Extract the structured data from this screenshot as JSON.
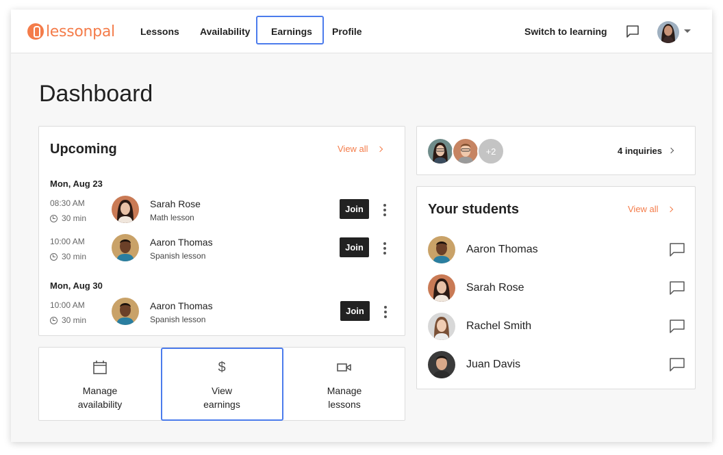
{
  "brand": {
    "name": "lessonpal",
    "accent": "#f47c4a"
  },
  "nav": {
    "items": [
      {
        "label": "Lessons"
      },
      {
        "label": "Availability"
      },
      {
        "label": "Earnings"
      },
      {
        "label": "Profile"
      }
    ],
    "switch_label": "Switch to learning",
    "message_icon": "chat-bubble-icon",
    "user_menu_icon": "chevron-down-icon"
  },
  "page": {
    "title": "Dashboard"
  },
  "upcoming": {
    "title": "Upcoming",
    "view_all": "View all",
    "groups": [
      {
        "date": "Mon, Aug 23",
        "lessons": [
          {
            "time": "08:30 AM",
            "duration": "30 min",
            "name": "Sarah Rose",
            "subject": "Math lesson",
            "join": "Join"
          },
          {
            "time": "10:00 AM",
            "duration": "30 min",
            "name": "Aaron Thomas",
            "subject": "Spanish lesson",
            "join": "Join"
          }
        ]
      },
      {
        "date": "Mon, Aug 30",
        "lessons": [
          {
            "time": "10:00 AM",
            "duration": "30 min",
            "name": "Aaron Thomas",
            "subject": "Spanish lesson",
            "join": "Join"
          }
        ]
      }
    ]
  },
  "actions": [
    {
      "label": "Manage\navailability",
      "icon": "calendar-icon"
    },
    {
      "label": "View\nearnings",
      "icon": "dollar-icon"
    },
    {
      "label": "Manage\nlessons",
      "icon": "video-camera-icon"
    }
  ],
  "inquiries": {
    "extra": "+2",
    "label": "4 inquiries"
  },
  "students": {
    "title": "Your students",
    "view_all": "View all",
    "list": [
      {
        "name": "Aaron Thomas"
      },
      {
        "name": "Sarah Rose"
      },
      {
        "name": "Rachel Smith"
      },
      {
        "name": "Juan Davis"
      }
    ]
  },
  "colors": {
    "highlight": "#4b7bec",
    "join_bg": "#222222"
  }
}
